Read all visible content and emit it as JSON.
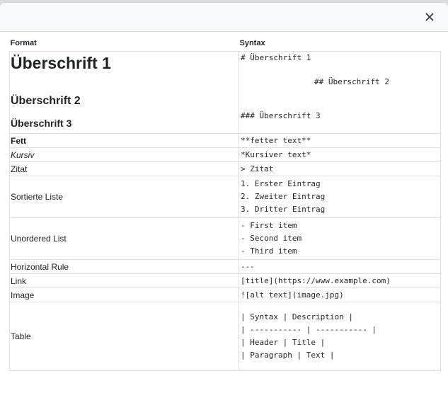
{
  "dialog": {
    "close_icon": "close-icon"
  },
  "table": {
    "headers": {
      "format": "Format",
      "syntax": "Syntax"
    },
    "headings": {
      "format": [
        "Überschrift 1",
        "Überschrift 2",
        "Überschrift 3"
      ],
      "syntax": [
        "# Überschrift 1",
        "## Überschrift 2",
        "### Überschrift 3"
      ]
    },
    "bold": {
      "format": "Fett",
      "syntax": "**fetter text**"
    },
    "italic": {
      "format": "Kursiv",
      "syntax": "*Kursiver text*"
    },
    "quote": {
      "format": "Zitat",
      "syntax": "> Zitat"
    },
    "ordered_list": {
      "format": "Sortierte Liste",
      "syntax": [
        "1. Erster Eintrag",
        "2. Zweiter Eintrag",
        "3. Dritter Eintrag"
      ]
    },
    "unordered_list": {
      "format": "Unordered List",
      "syntax": [
        "- First item",
        "- Second item",
        "- Third item"
      ]
    },
    "hr": {
      "format": "Horizontal Rule",
      "syntax": "---"
    },
    "link": {
      "format": "Link",
      "syntax": "[title](https://www.example.com)"
    },
    "image": {
      "format": "Image",
      "syntax": "![alt text](image.jpg)"
    },
    "table_row": {
      "format": "Table",
      "syntax": [
        "| Syntax | Description |",
        "| ----------- | ----------- |",
        "| Header | Title |",
        "| Paragraph | Text |"
      ]
    }
  }
}
